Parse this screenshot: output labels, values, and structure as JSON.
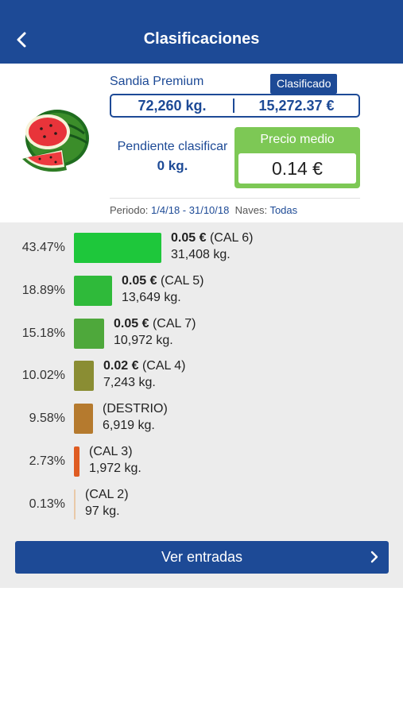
{
  "header": {
    "title": "Clasificaciones",
    "back_icon": "back-arrow-icon"
  },
  "product": {
    "name": "Sandia Premium",
    "status": "Clasificado",
    "total_kg": "72,260 kg.",
    "total_eur": "15,272.37 €",
    "pending_label": "Pendiente clasificar",
    "pending_value": "0 kg.",
    "avg_price_label": "Precio medio",
    "avg_price_value": "0.14 €",
    "period_label": "Periodo:",
    "period_value": "1/4/18 - 31/10/18",
    "naves_label": "Naves:",
    "naves_value": "Todas",
    "image": "watermelon-image"
  },
  "classes": [
    {
      "pct": "43.47%",
      "fraction": 0.4347,
      "price": "0.05 €",
      "name": "(CAL 6)",
      "kg": "31,408 kg.",
      "color": "#1ec73b"
    },
    {
      "pct": "18.89%",
      "fraction": 0.1889,
      "price": "0.05 €",
      "name": "(CAL 5)",
      "kg": "13,649 kg.",
      "color": "#2fba3a"
    },
    {
      "pct": "15.18%",
      "fraction": 0.1518,
      "price": "0.05 €",
      "name": "(CAL 7)",
      "kg": "10,972 kg.",
      "color": "#4ea83b"
    },
    {
      "pct": "10.02%",
      "fraction": 0.1002,
      "price": "0.02 €",
      "name": "(CAL 4)",
      "kg": "7,243 kg.",
      "color": "#8a8d33"
    },
    {
      "pct": "9.58%",
      "fraction": 0.0958,
      "price": "",
      "name": "(DESTRIO)",
      "kg": "6,919 kg.",
      "color": "#b57a2e"
    },
    {
      "pct": "2.73%",
      "fraction": 0.0273,
      "price": "",
      "name": "(CAL 3)",
      "kg": "1,972 kg.",
      "color": "#df5c22"
    },
    {
      "pct": "0.13%",
      "fraction": 0.0013,
      "price": "",
      "name": "(CAL 2)",
      "kg": "97 kg.",
      "color": "#e9c9a8"
    }
  ],
  "cta": {
    "label": "Ver entradas",
    "icon": "chevron-right-icon"
  }
}
